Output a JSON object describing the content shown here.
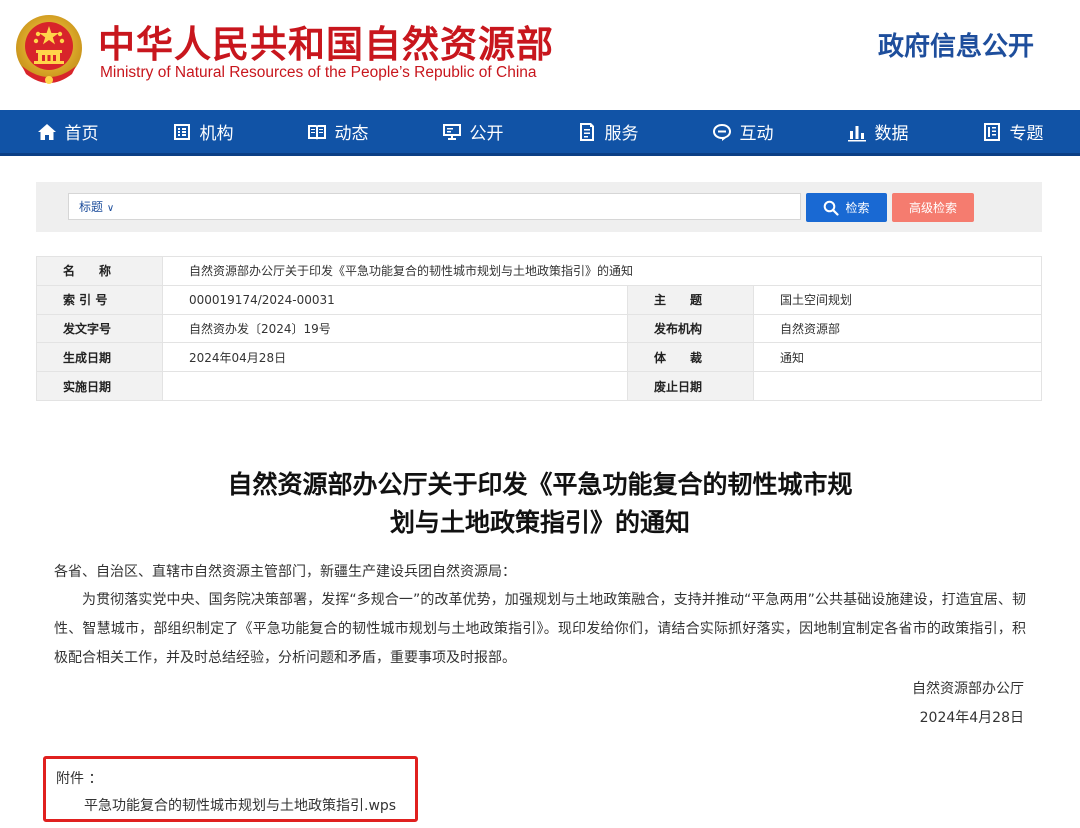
{
  "header": {
    "title_cn": "中华人民共和国自然资源部",
    "title_en": "Ministry of Natural Resources of the People’s Republic of China",
    "gov_info": "政府信息公开",
    "emblem_icon": "national-emblem-icon"
  },
  "colors": {
    "brand_red": "#c8161d",
    "nav_blue": "#1153a6",
    "search_blue": "#1969d3",
    "advanced_red": "#f57c6f",
    "highlight_red": "#e0201f"
  },
  "nav": {
    "items": [
      {
        "label": "首页",
        "icon": "home-icon"
      },
      {
        "label": "机构",
        "icon": "organization-icon"
      },
      {
        "label": "动态",
        "icon": "news-icon"
      },
      {
        "label": "公开",
        "icon": "disclosure-icon"
      },
      {
        "label": "服务",
        "icon": "service-icon"
      },
      {
        "label": "互动",
        "icon": "interaction-icon"
      },
      {
        "label": "数据",
        "icon": "data-chart-icon"
      },
      {
        "label": "专题",
        "icon": "topic-icon"
      }
    ]
  },
  "search": {
    "type_selected": "标题",
    "input_value": "",
    "search_button": "检索",
    "advanced_button": "高级检索"
  },
  "info": {
    "name_label": "名　　称",
    "name_value": "自然资源部办公厅关于印发《平急功能复合的韧性城市规划与土地政策指引》的通知",
    "index_label": "索 引 号",
    "index_value": "000019174/2024-00031",
    "subject_label": "主　　题",
    "subject_value": "国土空间规划",
    "doc_no_label": "发文字号",
    "doc_no_value": "自然资办发〔2024〕19号",
    "issuer_label": "发布机构",
    "issuer_value": "自然资源部",
    "date_label": "生成日期",
    "date_value": "2024年04月28日",
    "genre_label": "体　　裁",
    "genre_value": "通知",
    "effective_label": "实施日期",
    "effective_value": "",
    "expiry_label": "废止日期",
    "expiry_value": ""
  },
  "document": {
    "title_line1": "自然资源部办公厅关于印发《平急功能复合的韧性城市规",
    "title_line2": "划与土地政策指引》的通知",
    "addressee": "各省、自治区、直辖市自然资源主管部门，新疆生产建设兵团自然资源局：",
    "body": "为贯彻落实党中央、国务院决策部署，发挥“多规合一”的改革优势，加强规划与土地政策融合，支持并推动“平急两用”公共基础设施建设，打造宜居、韧性、智慧城市，部组织制定了《平急功能复合的韧性城市规划与土地政策指引》。现印发给你们，请结合实际抓好落实，因地制宜制定各省市的政策指引，积极配合相关工作，并及时总结经验，分析问题和矛盾，重要事项及时报部。",
    "signature_org": "自然资源部办公厅",
    "signature_date": "2024年4月28日"
  },
  "attachment": {
    "label": "附件 ：",
    "file_name": "平急功能复合的韧性城市规划与土地政策指引.wps"
  }
}
